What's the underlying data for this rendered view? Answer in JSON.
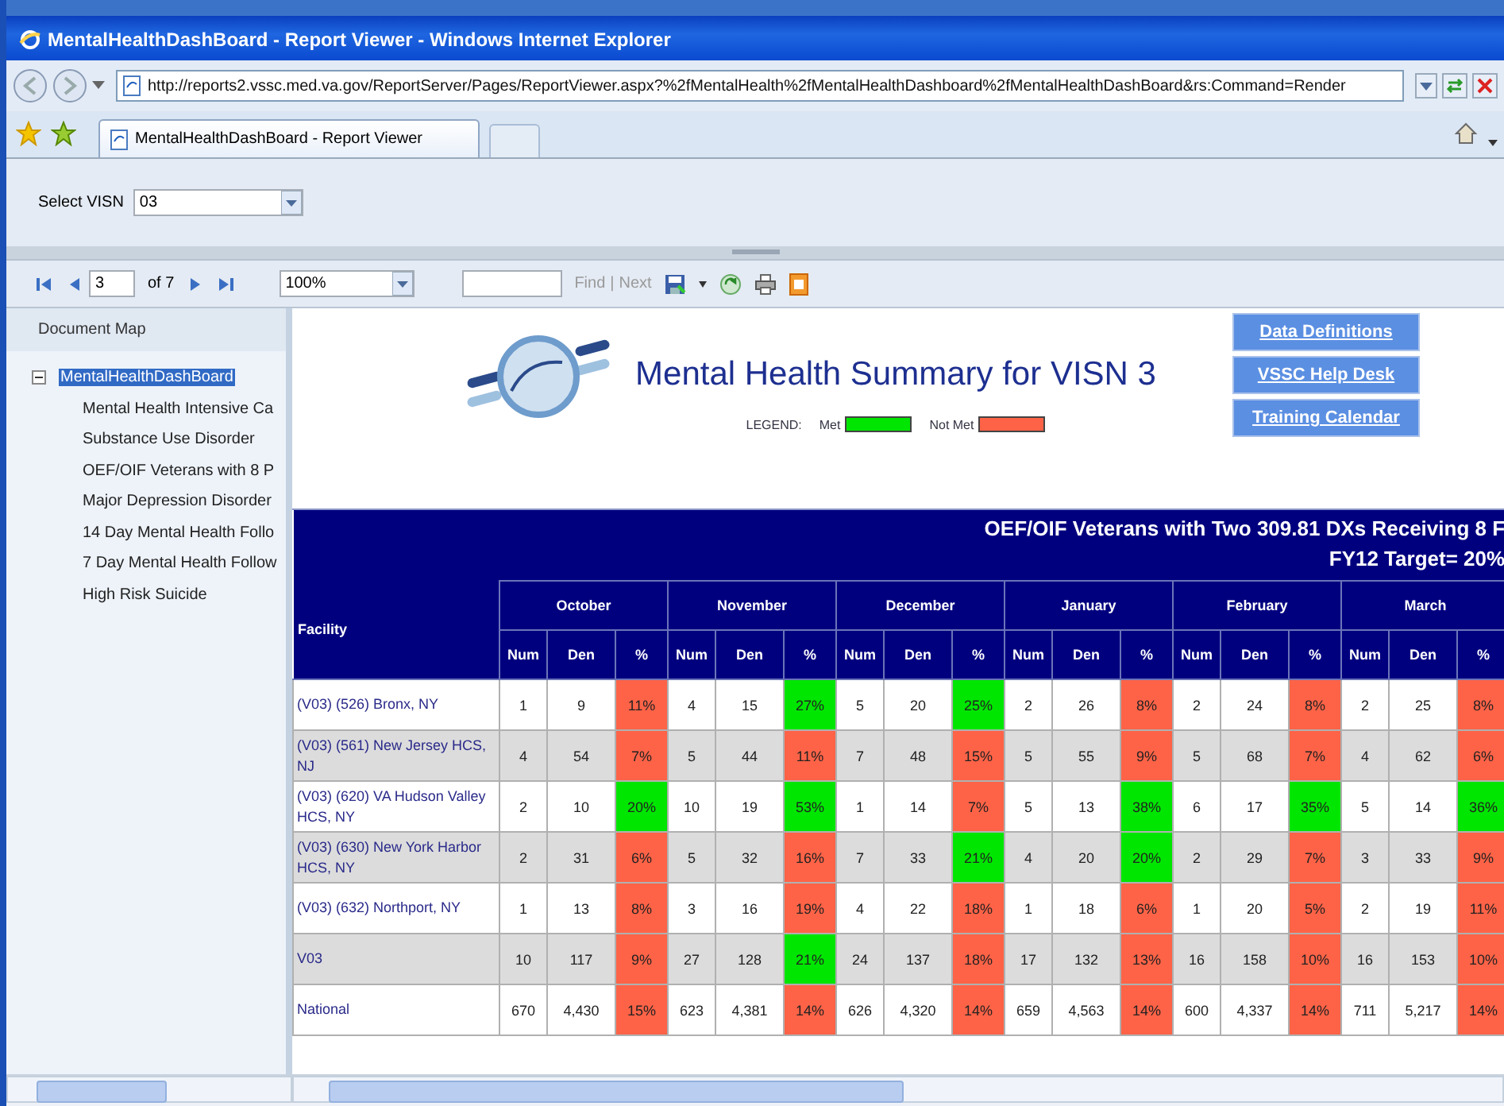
{
  "window": {
    "title": "MentalHealthDashBoard - Report Viewer - Windows Internet Explorer"
  },
  "address_bar": {
    "url": "http://reports2.vssc.med.va.gov/ReportServer/Pages/ReportViewer.aspx?%2fMentalHealth%2fMentalHealthDashboard%2fMentalHealthDashBoard&rs:Command=Render"
  },
  "tabs": [
    {
      "label": "MentalHealthDashBoard - Report Viewer",
      "selected": true
    }
  ],
  "parameters": {
    "label": "Select VISN",
    "value": "03"
  },
  "toolbar": {
    "page": "3",
    "page_count": "of 7",
    "zoom": "100%",
    "find": "Find",
    "separator": "|",
    "next": "Next",
    "find_disabled": true
  },
  "document_map": {
    "title": "Document Map",
    "tree": [
      {
        "label": "MentalHealthDashBoard",
        "selected": true,
        "expanded": true,
        "children": [
          {
            "label": "Mental Health Intensive Ca",
            "selected": false
          },
          {
            "label": "Substance Use Disorder",
            "selected": false
          },
          {
            "label": "OEF/OIF Veterans with 8 P",
            "selected": false
          },
          {
            "label": "Major Depression Disorder",
            "selected": false
          },
          {
            "label": "14 Day Mental Health Follo",
            "selected": false
          },
          {
            "label": "7 Day Mental Health Follow",
            "selected": false
          },
          {
            "label": "High Risk Suicide",
            "selected": false
          }
        ]
      }
    ]
  },
  "report": {
    "title": "Mental Health Summary for VISN 3",
    "legend": {
      "label": "LEGEND:",
      "items": [
        {
          "kind": "met",
          "label": "Met",
          "color": "#00e600"
        },
        {
          "kind": "not_met",
          "label": "Not Met",
          "color": "#ff6347"
        }
      ]
    },
    "links": [
      "Data Definitions",
      "VSSC Help Desk",
      "Training Calendar"
    ],
    "table": {
      "title_lines": [
        "OEF/OIF Veterans with Two 309.81 DXs Receiving 8 F",
        "FY12 Target= 20%"
      ],
      "facility_header": "Facility",
      "months": [
        {
          "label": "October",
          "subheaders": [
            "Num",
            "Den",
            "%"
          ]
        },
        {
          "label": "November",
          "subheaders": [
            "Num",
            "Den",
            "%"
          ]
        },
        {
          "label": "December",
          "subheaders": [
            "Num",
            "Den",
            "%"
          ]
        },
        {
          "label": "January",
          "subheaders": [
            "Num",
            "Den",
            "%"
          ]
        },
        {
          "label": "February",
          "subheaders": [
            "Num",
            "Den",
            "%"
          ]
        },
        {
          "label": "March",
          "subheaders": [
            "Num",
            "Den",
            "%"
          ]
        }
      ],
      "rows": [
        {
          "facility": "(V03) (526) Bronx, NY",
          "cells": [
            {
              "num": "1",
              "den": "9",
              "pct": "11%",
              "met": false
            },
            {
              "num": "4",
              "den": "15",
              "pct": "27%",
              "met": true
            },
            {
              "num": "5",
              "den": "20",
              "pct": "25%",
              "met": true
            },
            {
              "num": "2",
              "den": "26",
              "pct": "8%",
              "met": false
            },
            {
              "num": "2",
              "den": "24",
              "pct": "8%",
              "met": false
            },
            {
              "num": "2",
              "den": "25",
              "pct": "8%",
              "met": false
            }
          ]
        },
        {
          "facility": "(V03) (561) New Jersey HCS, NJ",
          "cells": [
            {
              "num": "4",
              "den": "54",
              "pct": "7%",
              "met": false
            },
            {
              "num": "5",
              "den": "44",
              "pct": "11%",
              "met": false
            },
            {
              "num": "7",
              "den": "48",
              "pct": "15%",
              "met": false
            },
            {
              "num": "5",
              "den": "55",
              "pct": "9%",
              "met": false
            },
            {
              "num": "5",
              "den": "68",
              "pct": "7%",
              "met": false
            },
            {
              "num": "4",
              "den": "62",
              "pct": "6%",
              "met": false
            }
          ]
        },
        {
          "facility": "(V03) (620) VA Hudson Valley HCS, NY",
          "cells": [
            {
              "num": "2",
              "den": "10",
              "pct": "20%",
              "met": true
            },
            {
              "num": "10",
              "den": "19",
              "pct": "53%",
              "met": true
            },
            {
              "num": "1",
              "den": "14",
              "pct": "7%",
              "met": false
            },
            {
              "num": "5",
              "den": "13",
              "pct": "38%",
              "met": true
            },
            {
              "num": "6",
              "den": "17",
              "pct": "35%",
              "met": true
            },
            {
              "num": "5",
              "den": "14",
              "pct": "36%",
              "met": true
            }
          ]
        },
        {
          "facility": "(V03) (630) New York Harbor HCS, NY",
          "cells": [
            {
              "num": "2",
              "den": "31",
              "pct": "6%",
              "met": false
            },
            {
              "num": "5",
              "den": "32",
              "pct": "16%",
              "met": false
            },
            {
              "num": "7",
              "den": "33",
              "pct": "21%",
              "met": true
            },
            {
              "num": "4",
              "den": "20",
              "pct": "20%",
              "met": true
            },
            {
              "num": "2",
              "den": "29",
              "pct": "7%",
              "met": false
            },
            {
              "num": "3",
              "den": "33",
              "pct": "9%",
              "met": false
            }
          ]
        },
        {
          "facility": "(V03) (632) Northport, NY",
          "cells": [
            {
              "num": "1",
              "den": "13",
              "pct": "8%",
              "met": false
            },
            {
              "num": "3",
              "den": "16",
              "pct": "19%",
              "met": false
            },
            {
              "num": "4",
              "den": "22",
              "pct": "18%",
              "met": false
            },
            {
              "num": "1",
              "den": "18",
              "pct": "6%",
              "met": false
            },
            {
              "num": "1",
              "den": "20",
              "pct": "5%",
              "met": false
            },
            {
              "num": "2",
              "den": "19",
              "pct": "11%",
              "met": false
            }
          ]
        },
        {
          "facility": "V03",
          "cells": [
            {
              "num": "10",
              "den": "117",
              "pct": "9%",
              "met": false
            },
            {
              "num": "27",
              "den": "128",
              "pct": "21%",
              "met": true
            },
            {
              "num": "24",
              "den": "137",
              "pct": "18%",
              "met": false
            },
            {
              "num": "17",
              "den": "132",
              "pct": "13%",
              "met": false
            },
            {
              "num": "16",
              "den": "158",
              "pct": "10%",
              "met": false
            },
            {
              "num": "16",
              "den": "153",
              "pct": "10%",
              "met": false
            }
          ]
        },
        {
          "facility": "National",
          "cells": [
            {
              "num": "670",
              "den": "4,430",
              "pct": "15%",
              "met": false
            },
            {
              "num": "623",
              "den": "4,381",
              "pct": "14%",
              "met": false
            },
            {
              "num": "626",
              "den": "4,320",
              "pct": "14%",
              "met": false
            },
            {
              "num": "659",
              "den": "4,563",
              "pct": "14%",
              "met": false
            },
            {
              "num": "600",
              "den": "4,337",
              "pct": "14%",
              "met": false
            },
            {
              "num": "711",
              "den": "5,217",
              "pct": "14%",
              "met": false
            }
          ]
        }
      ]
    }
  }
}
